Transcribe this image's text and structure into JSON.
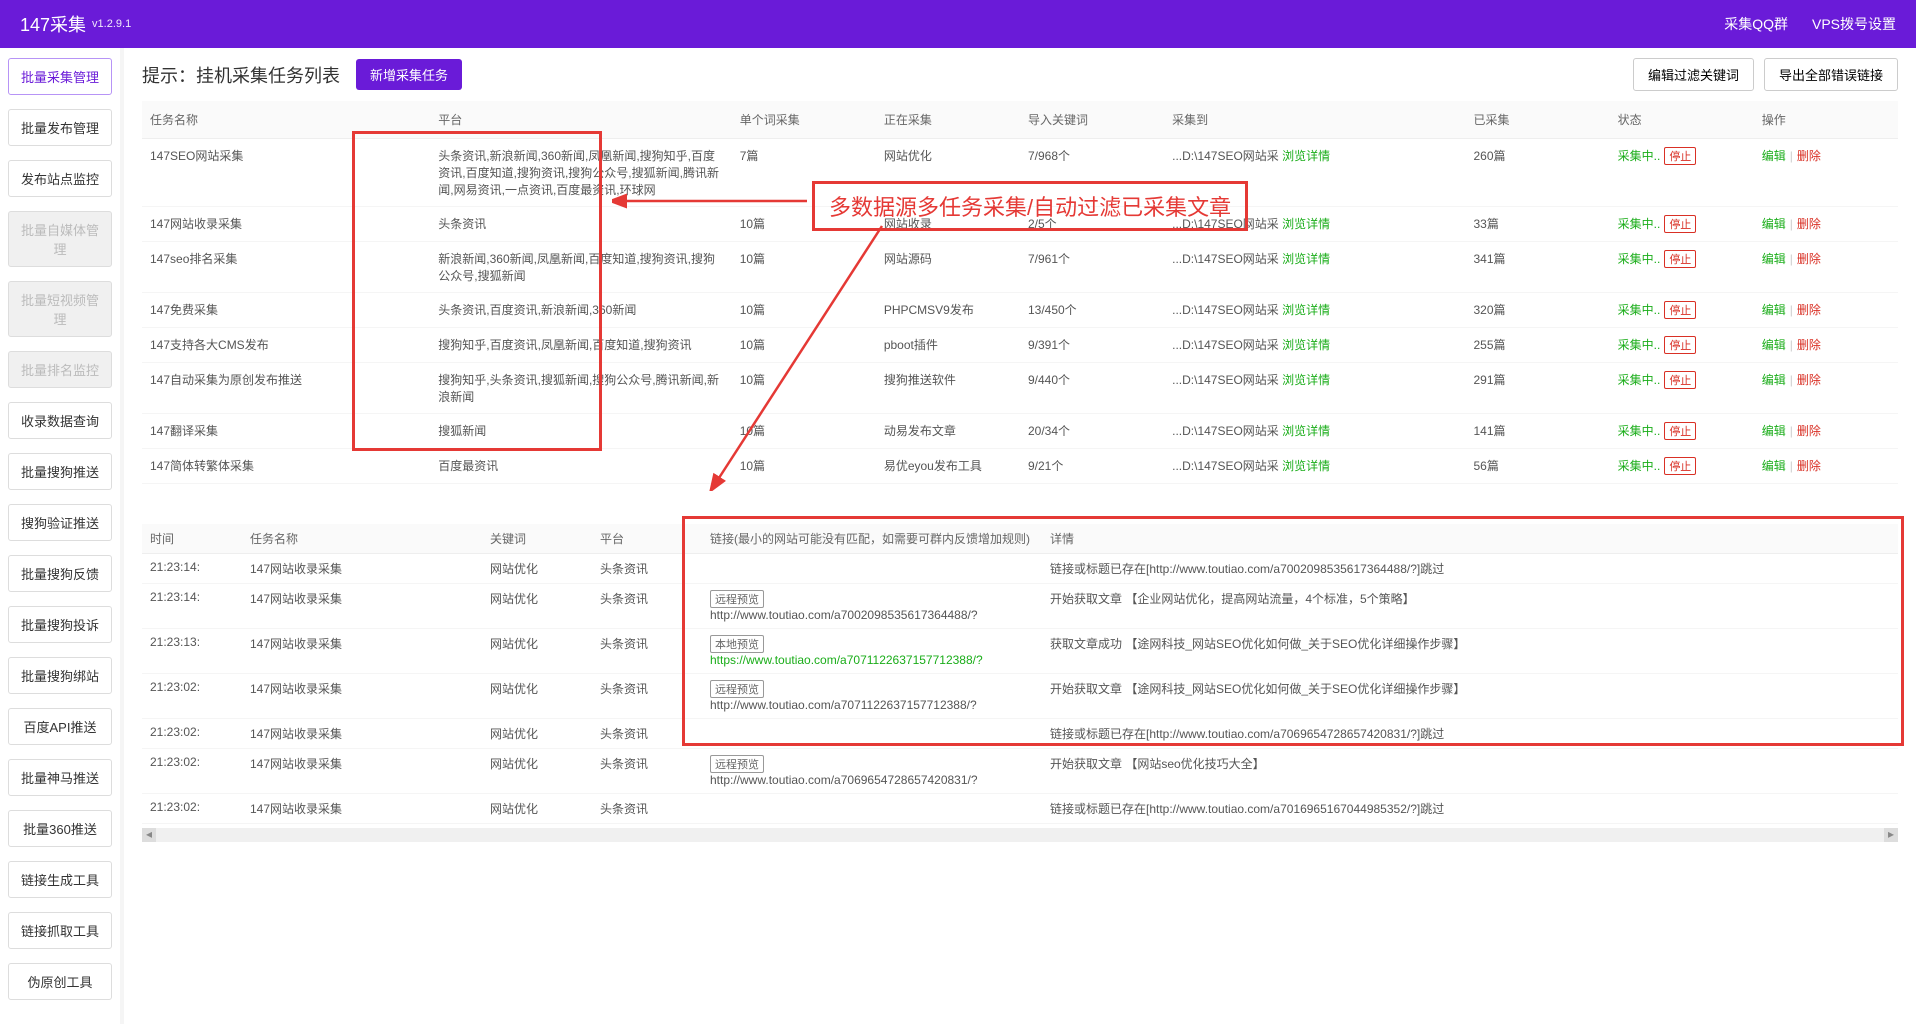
{
  "header": {
    "title": "147采集",
    "version": "v1.2.9.1",
    "links": [
      "采集QQ群",
      "VPS拨号设置"
    ]
  },
  "sidebar": {
    "items": [
      {
        "label": "批量采集管理",
        "state": "active"
      },
      {
        "label": "批量发布管理",
        "state": "normal"
      },
      {
        "label": "发布站点监控",
        "state": "normal"
      },
      {
        "label": "批量自媒体管理",
        "state": "disabled"
      },
      {
        "label": "批量短视频管理",
        "state": "disabled"
      },
      {
        "label": "批量排名监控",
        "state": "disabled"
      },
      {
        "label": "收录数据查询",
        "state": "normal"
      },
      {
        "label": "批量搜狗推送",
        "state": "normal"
      },
      {
        "label": "搜狗验证推送",
        "state": "normal"
      },
      {
        "label": "批量搜狗反馈",
        "state": "normal"
      },
      {
        "label": "批量搜狗投诉",
        "state": "normal"
      },
      {
        "label": "批量搜狗绑站",
        "state": "normal"
      },
      {
        "label": "百度API推送",
        "state": "normal"
      },
      {
        "label": "批量神马推送",
        "state": "normal"
      },
      {
        "label": "批量360推送",
        "state": "normal"
      },
      {
        "label": "链接生成工具",
        "state": "normal"
      },
      {
        "label": "链接抓取工具",
        "state": "normal"
      },
      {
        "label": "伪原创工具",
        "state": "normal"
      }
    ]
  },
  "toolbar": {
    "title": "提示：挂机采集任务列表",
    "new_task": "新增采集任务",
    "edit_filter": "编辑过滤关键词",
    "export_errors": "导出全部错误链接"
  },
  "task_table": {
    "headers": [
      "任务名称",
      "平台",
      "单个词采集",
      "正在采集",
      "导入关键词",
      "采集到",
      "已采集",
      "状态",
      "操作"
    ],
    "detail_label": "浏览详情",
    "status_label": "采集中..",
    "stop_label": "停止",
    "edit_label": "编辑",
    "delete_label": "删除",
    "rows": [
      {
        "name": "147SEO网站采集",
        "platform": "头条资讯,新浪新闻,360新闻,凤凰新闻,搜狗知乎,百度资讯,百度知道,搜狗资讯,搜狗公众号,搜狐新闻,腾讯新闻,网易资讯,一点资讯,百度最资讯,环球网",
        "single": "7篇",
        "collecting": "网站优化",
        "import": "7/968个",
        "dest": "...D:\\147SEO网站采",
        "count": "260篇"
      },
      {
        "name": "147网站收录采集",
        "platform": "头条资讯",
        "single": "10篇",
        "collecting": "网站收录",
        "import": "2/5个",
        "dest": "...D:\\147SEO网站采",
        "count": "33篇"
      },
      {
        "name": "147seo排名采集",
        "platform": "新浪新闻,360新闻,凤凰新闻,百度知道,搜狗资讯,搜狗公众号,搜狐新闻",
        "single": "10篇",
        "collecting": "网站源码",
        "import": "7/961个",
        "dest": "...D:\\147SEO网站采",
        "count": "341篇"
      },
      {
        "name": "147免费采集",
        "platform": "头条资讯,百度资讯,新浪新闻,360新闻",
        "single": "10篇",
        "collecting": "PHPCMSV9发布",
        "import": "13/450个",
        "dest": "...D:\\147SEO网站采",
        "count": "320篇"
      },
      {
        "name": "147支持各大CMS发布",
        "platform": "搜狗知乎,百度资讯,凤凰新闻,百度知道,搜狗资讯",
        "single": "10篇",
        "collecting": "pboot插件",
        "import": "9/391个",
        "dest": "...D:\\147SEO网站采",
        "count": "255篇"
      },
      {
        "name": "147自动采集为原创发布推送",
        "platform": "搜狗知乎,头条资讯,搜狐新闻,搜狗公众号,腾讯新闻,新浪新闻",
        "single": "10篇",
        "collecting": "搜狗推送软件",
        "import": "9/440个",
        "dest": "...D:\\147SEO网站采",
        "count": "291篇"
      },
      {
        "name": "147翻译采集",
        "platform": "搜狐新闻",
        "single": "10篇",
        "collecting": "动易发布文章",
        "import": "20/34个",
        "dest": "...D:\\147SEO网站采",
        "count": "141篇"
      },
      {
        "name": "147简体转繁体采集",
        "platform": "百度最资讯",
        "single": "10篇",
        "collecting": "易优eyou发布工具",
        "import": "9/21个",
        "dest": "...D:\\147SEO网站采",
        "count": "56篇"
      }
    ]
  },
  "annotation": {
    "text": "多数据源多任务采集/自动过滤已采集文章"
  },
  "log_table": {
    "headers": [
      "时间",
      "任务名称",
      "关键词",
      "平台",
      "链接(最小的网站可能没有匹配，如需要可群内反馈增加规则)",
      "详情"
    ],
    "remote_badge": "远程预览",
    "local_badge": "本地预览",
    "rows": [
      {
        "time": "21:23:14:",
        "task": "147网站收录采集",
        "kw": "网站优化",
        "plat": "头条资讯",
        "badge": "",
        "url": "",
        "detail": "链接或标题已存在[http://www.toutiao.com/a7002098535617364488/?]跳过"
      },
      {
        "time": "21:23:14:",
        "task": "147网站收录采集",
        "kw": "网站优化",
        "plat": "头条资讯",
        "badge": "remote",
        "url": "http://www.toutiao.com/a7002098535617364488/?",
        "detail": "开始获取文章 【企业网站优化，提高网站流量，4个标准，5个策略】"
      },
      {
        "time": "21:23:13:",
        "task": "147网站收录采集",
        "kw": "网站优化",
        "plat": "头条资讯",
        "badge": "local",
        "url": "https://www.toutiao.com/a7071122637157712388/?",
        "url_green": true,
        "detail": "获取文章成功 【途网科技_网站SEO优化如何做_关于SEO优化详细操作步骤】"
      },
      {
        "time": "21:23:02:",
        "task": "147网站收录采集",
        "kw": "网站优化",
        "plat": "头条资讯",
        "badge": "remote",
        "url": "http://www.toutiao.com/a7071122637157712388/?",
        "detail": "开始获取文章 【途网科技_网站SEO优化如何做_关于SEO优化详细操作步骤】"
      },
      {
        "time": "21:23:02:",
        "task": "147网站收录采集",
        "kw": "网站优化",
        "plat": "头条资讯",
        "badge": "",
        "url": "",
        "detail": "链接或标题已存在[http://www.toutiao.com/a7069654728657420831/?]跳过"
      },
      {
        "time": "21:23:02:",
        "task": "147网站收录采集",
        "kw": "网站优化",
        "plat": "头条资讯",
        "badge": "remote",
        "url": "http://www.toutiao.com/a7069654728657420831/?",
        "detail": "开始获取文章 【网站seo优化技巧大全】"
      },
      {
        "time": "21:23:02:",
        "task": "147网站收录采集",
        "kw": "网站优化",
        "plat": "头条资讯",
        "badge": "",
        "url": "",
        "detail": "链接或标题已存在[http://www.toutiao.com/a7016965167044985352/?]跳过"
      }
    ]
  }
}
